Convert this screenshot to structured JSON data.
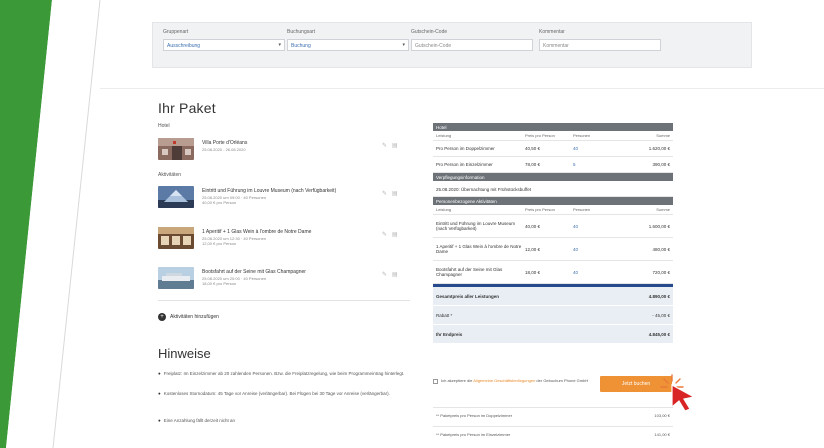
{
  "filters": [
    {
      "label": "Gruppenart",
      "value": "Ausschreibung",
      "dropdown": true
    },
    {
      "label": "Buchungsart",
      "value": "Buchung",
      "dropdown": true
    },
    {
      "label": "Gutschein-Code",
      "value": "Gutschein-Code",
      "dropdown": false
    },
    {
      "label": "Kommentar",
      "value": "Kommentar",
      "dropdown": false
    }
  ],
  "page": {
    "title": "Ihr Paket"
  },
  "sections": {
    "hotel": "Hotel",
    "activities": "Aktivitäten"
  },
  "package_items": [
    {
      "title": "Villa Porte d'Orléans",
      "sub": "25.08.2020 - 26.08.2020",
      "sub2": ""
    },
    {
      "title": "Eintritt und Führung im Louvre Museum (nach Verfügbarkeit)",
      "sub": "25.08.2020 um 09:00 · 40 Personen",
      "sub2": "40,00 € pro Person"
    },
    {
      "title": "1 Aperitif + 1 Glas Wein à l'ombre de Notre Dame",
      "sub": "25.08.2020 um 12:30 · 40 Personen",
      "sub2": "12,00 € pro Person"
    },
    {
      "title": "Bootsfahrt auf der Seine mit Glas Champagner",
      "sub": "25.08.2020 um 20:00 · 40 Personen",
      "sub2": "18,00 € pro Person"
    }
  ],
  "add_activity_label": "Aktivitäten hinzufügen",
  "notes": {
    "title": "Hinweise",
    "items": [
      "Freiplatz: Im Einzelzimmer ab 20 zahlenden Personen. Bzw. die Freiplatzregelung, wie beim Programmeintrag hinterlegt.",
      "Kostenloses Stornodatum: 45 Tage vor Anreise (verlängerbar). Bei Flügen bei 30 Tage vor Anreise (verlängerbar).",
      "Eine Anzahlung fällt derzeit nicht an"
    ]
  },
  "summary": {
    "hotel_head": "Hotel",
    "columns": [
      "Leistung",
      "Preis pro Person",
      "Personen",
      "Summe"
    ],
    "hotel_rows": [
      {
        "name": "Pro Person im Doppelzimmer",
        "price": "40,50 €",
        "persons": "40",
        "sum": "1.620,00 €"
      },
      {
        "name": "Pro Person im Einzelzimmer",
        "price": "78,00 €",
        "persons": "5",
        "sum": "390,00 €"
      }
    ],
    "catering_head": "Verpflegungsinformation",
    "catering_text": "25.08.2020: Übernachtung mit Frühstücksbuffet",
    "activities_head": "Personenbezogene Aktivitäten",
    "activity_rows": [
      {
        "name": "Eintritt und Führung im Louvre Museum (nach Verfügbarkeit)",
        "price": "40,00 €",
        "persons": "40",
        "sum": "1.600,00 €"
      },
      {
        "name": "1 Aperitif + 1 Glas Wein à l'ombre de Notre Dame",
        "price": "12,00 €",
        "persons": "40",
        "sum": "480,00 €"
      },
      {
        "name": "Bootsfahrt auf der Seine mit Glas Champagner",
        "price": "18,00 €",
        "persons": "40",
        "sum": "720,00 €"
      }
    ],
    "totals": [
      {
        "label": "Gesamtpreis aller Leistungen",
        "value": "4.890,00 €",
        "bold": true
      },
      {
        "label": "Rabatt *",
        "value": "- 45,00 €",
        "bold": false
      },
      {
        "label": "Ihr Endpreis",
        "value": "4.845,00 €",
        "bold": true
      }
    ]
  },
  "agb": {
    "prefix": "Ich akzeptiere die",
    "link": "Allgemeine Geschäftsbedingungen",
    "suffix": "der Gebuchum Phone GmbH"
  },
  "book_button": "Jetzt buchen",
  "extra_rows": [
    {
      "label": "** Paketpreis pro Person im Doppelzimmer",
      "value": "103,00 €"
    },
    {
      "label": "** Paketpreis pro Person im Einzelzimmer",
      "value": "141,00 €"
    }
  ],
  "colors": {
    "accent_green": "#3a9a37",
    "button_orange": "#ef9235",
    "header_gray": "#6d7278",
    "navy": "#264b8c",
    "link_blue": "#3a6fb0"
  }
}
